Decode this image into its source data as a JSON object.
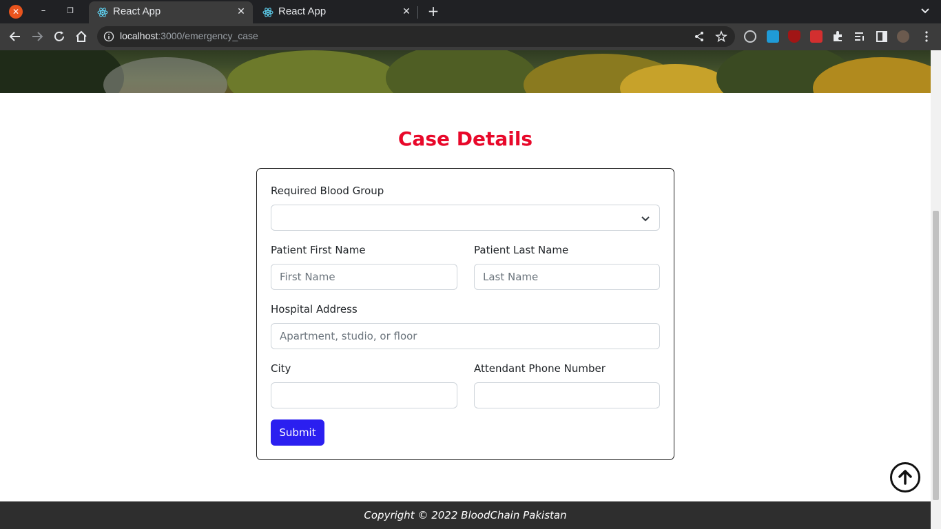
{
  "browser": {
    "tabs": [
      {
        "title": "React App",
        "active": true
      },
      {
        "title": "React App",
        "active": false
      }
    ],
    "new_tab_label": "+",
    "url_host": "localhost",
    "url_path": ":3000/emergency_case"
  },
  "page": {
    "heading": "Case Details",
    "form": {
      "blood_group_label": "Required Blood Group",
      "blood_group_value": "",
      "first_name_label": "Patient First Name",
      "first_name_placeholder": "First Name",
      "last_name_label": "Patient Last Name",
      "last_name_placeholder": "Last Name",
      "hospital_label": "Hospital Address",
      "hospital_placeholder": "Apartment, studio, or floor",
      "city_label": "City",
      "city_value": "",
      "phone_label": "Attendant Phone Number",
      "phone_value": "",
      "submit_label": "Submit"
    },
    "footer": "Copyright © 2022 BloodChain Pakistan"
  },
  "colors": {
    "heading": "#e8082a",
    "submit": "#2b1ff0",
    "footer_bg": "#2e2e2e"
  },
  "icons": [
    "close-icon",
    "minimize-icon",
    "maximize-icon",
    "react-icon",
    "plus-icon",
    "chevron-down-icon",
    "back-icon",
    "forward-icon",
    "reload-icon",
    "home-icon",
    "info-icon",
    "share-icon",
    "star-icon",
    "extensions-icon",
    "arrow-up-icon"
  ]
}
